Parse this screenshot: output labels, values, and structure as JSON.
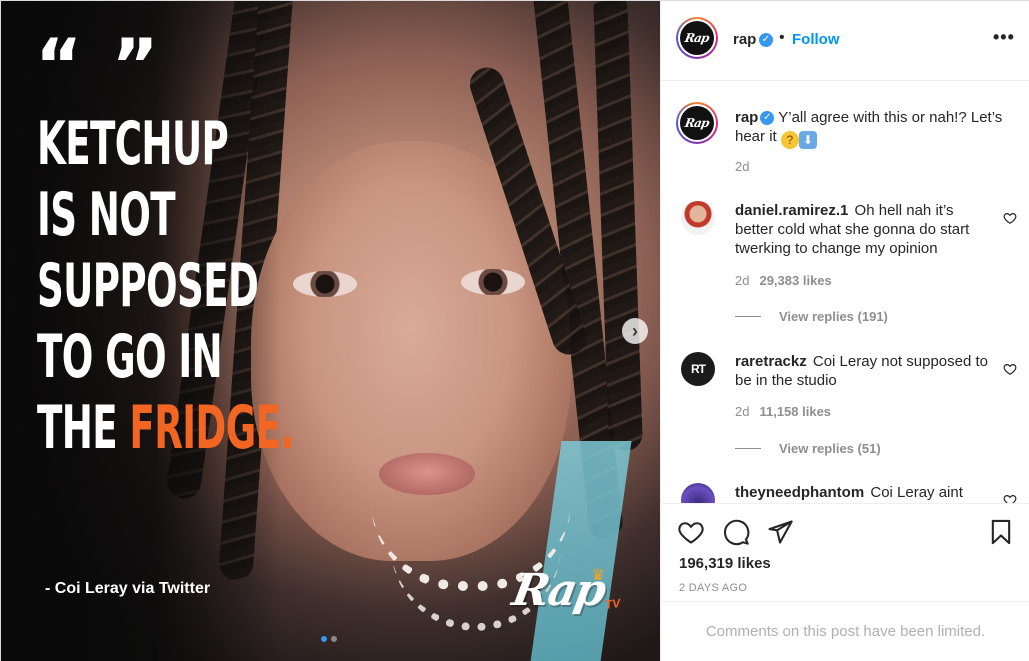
{
  "post": {
    "account": {
      "username": "rap",
      "avatar_text": "Rap",
      "follow_label": "Follow",
      "separator": "•",
      "verified_mark": "✓"
    },
    "more_label": "•••",
    "media": {
      "quote_marks": "“ ”",
      "headline_lines": [
        "KETCHUP",
        "IS NOT",
        "SUPPOSED",
        "TO GO IN"
      ],
      "headline_last_prefix": "THE ",
      "headline_last_accent": "FRIDGE.",
      "attribution": "- Coi Leray via Twitter",
      "watermark": {
        "word": "Rap",
        "tv": "TV",
        "crown": "♛"
      },
      "next_arrow": "›",
      "carousel": {
        "count": 2,
        "active_index": 0
      },
      "accent_color": "#f26522"
    },
    "caption": {
      "username": "rap",
      "text": " Y’all agree with this or nah!? Let’s hear it ",
      "emoji_1": "?",
      "emoji_2": "⬇",
      "time": "2d"
    },
    "comments": [
      {
        "username": "daniel.ramirez.1",
        "text": " Oh hell nah it’s better cold what she gonna do start twerking to change my opinion",
        "time": "2d",
        "likes": "29,383 likes",
        "replies": "View replies (191)",
        "avatar_text": ""
      },
      {
        "username": "raretrackz",
        "text": " Coi Leray not supposed to be in the studio",
        "time": "2d",
        "likes": "11,158 likes",
        "replies": "View replies (51)",
        "avatar_text": "RT"
      },
      {
        "username": "theyneedphantom",
        "text": " Coi Leray aint",
        "avatar_text": ""
      }
    ],
    "actions": {
      "likes": "196,319 likes",
      "posted": "2 DAYS AGO",
      "comments_limited": "Comments on this post have been limited."
    },
    "colors": {
      "link": "#0095f6",
      "verified": "#3897f0",
      "muted": "#8e8e8e",
      "text": "#262626"
    }
  }
}
